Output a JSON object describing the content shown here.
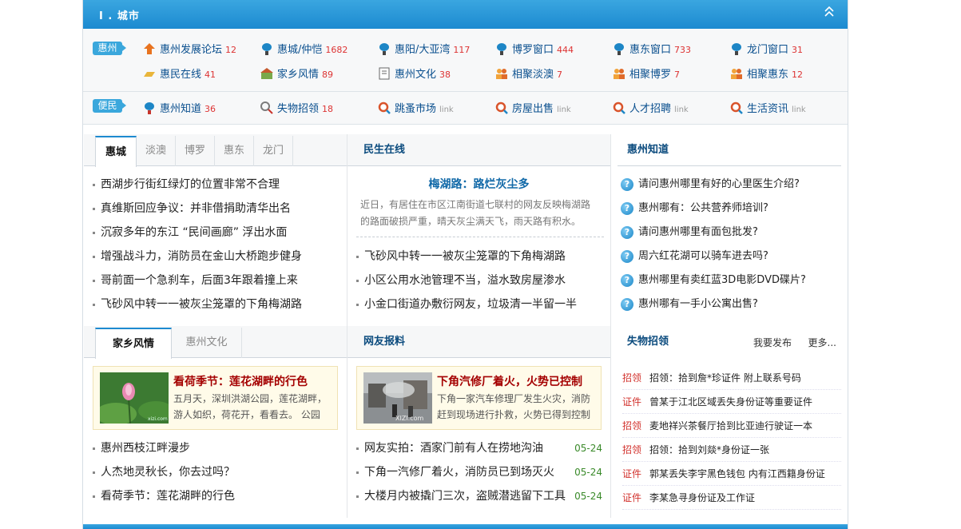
{
  "header": {
    "title": "I . 城市"
  },
  "city": {
    "tag1": "惠州",
    "tag2": "便民",
    "row1": [
      {
        "label": "惠州发展论坛",
        "count": "12",
        "icon": "house-up-icon"
      },
      {
        "label": "惠城/仲恺",
        "count": "1682",
        "icon": "lantern-icon"
      },
      {
        "label": "惠阳/大亚湾",
        "count": "117",
        "icon": "lantern-icon"
      },
      {
        "label": "博罗窗口",
        "count": "444",
        "icon": "lantern-icon"
      },
      {
        "label": "惠东窗口",
        "count": "733",
        "icon": "lantern-icon"
      },
      {
        "label": "龙门窗口",
        "count": "31",
        "icon": "lantern-icon"
      }
    ],
    "row2": [
      {
        "label": "惠民在线",
        "count": "41",
        "icon": "gold-bar-icon"
      },
      {
        "label": "家乡风情",
        "count": "89",
        "icon": "houses-icon"
      },
      {
        "label": "惠州文化",
        "count": "38",
        "icon": "book-icon"
      },
      {
        "label": "相聚淡澳",
        "count": "7",
        "icon": "people-icon"
      },
      {
        "label": "相聚博罗",
        "count": "7",
        "icon": "people-icon"
      },
      {
        "label": "相聚惠东",
        "count": "12",
        "icon": "people-icon"
      }
    ],
    "row3": [
      {
        "label": "惠州知道",
        "count": "36",
        "icon": "question-lantern-icon"
      },
      {
        "label": "失物招领",
        "count": "18",
        "icon": "lost-item-icon"
      },
      {
        "label": "跳蚤市场",
        "link": "link",
        "icon": "magnifier-icon"
      },
      {
        "label": "房屋出售",
        "link": "link",
        "icon": "magnifier-icon"
      },
      {
        "label": "人才招聘",
        "link": "link",
        "icon": "magnifier-icon"
      },
      {
        "label": "生活资讯",
        "link": "link",
        "icon": "magnifier-icon"
      }
    ]
  },
  "col1": {
    "tabs": [
      "惠城",
      "淡澳",
      "博罗",
      "惠东",
      "龙门"
    ],
    "news": [
      "西湖步行街红绿灯的位置非常不合理",
      "真维斯回应争议：并非借捐助清华出名",
      "沉寂多年的东江 “民间画廊” 浮出水面",
      "增强战斗力，消防员在金山大桥跑步健身",
      "哥前面一个急刹车，后面3年跟着撞上来",
      "飞砂风中转一一被灰尘笼罩的下角梅湖路"
    ],
    "tabs2": [
      "家乡风情",
      "惠州文化"
    ],
    "promo": {
      "title": "看荷季节：莲花湖畔的行色",
      "desc": "五月天，深圳洪湖公园，莲花湖畔，游人如织，荷花开，看看去。 公园",
      "img_mark": "xizi.com"
    },
    "news2": [
      "惠州西枝江畔漫步",
      "人杰地灵秋长，你去过吗？",
      "看荷季节：莲花湖畔的行色"
    ]
  },
  "col2": {
    "title": "民生在线",
    "feature_title": "梅湖路：路烂灰尘多",
    "feature_desc": "近日，有居住在市区江南街道七联村的网友反映梅湖路的路面破损严重，晴天灰尘满天飞，雨天路有积水。",
    "news": [
      "飞砂风中转一一被灰尘笼罩的下角梅湖路",
      "小区公用水池管理不当，溢水致房屋渗水",
      "小金口街道办敷衍网友，垃圾清一半留一半"
    ],
    "title2": "网友报料",
    "promo": {
      "title": "下角汽修厂着火，火势已控制",
      "desc": "下角一家汽车修理厂发生火灾，消防赶到现场进行扑救，火势已得到控制",
      "img_mark": "XIZI.com"
    },
    "reports": [
      {
        "text": "网友实拍：酒家门前有人在捞地沟油",
        "date": "05-24"
      },
      {
        "text": "下角一汽修厂着火，消防员已到场灭火",
        "date": "05-24"
      },
      {
        "text": "大楼月内被撬门三次，盗贼潜逃留下工具",
        "date": "05-24"
      }
    ]
  },
  "col3": {
    "title": "惠州知道",
    "questions": [
      "请问惠州哪里有好的心里医生介绍?",
      "惠州哪有：公共营养师培训?",
      "请问惠州哪里有面包批发?",
      "周六红花湖可以骑车进去吗?",
      "惠州哪里有卖红蓝3D电影DVD碟片?",
      "惠州哪有一手小公寓出售?"
    ],
    "title2": "失物招领",
    "publish": "我要发布",
    "more": "更多...",
    "lost": [
      {
        "kind": "招领",
        "text": "招领：拾到詹*珍证件 附上联系号码"
      },
      {
        "kind": "证件",
        "text": "曾某于江北区域丢失身份证等重要证件"
      },
      {
        "kind": "招领",
        "text": "麦地祥兴茶餐厅拾到比亚迪行驶证一本"
      },
      {
        "kind": "招领",
        "text": "招领：拾到刘燚*身份证一张"
      },
      {
        "kind": "证件",
        "text": "郭某丢失李宇黑色钱包 内有江西籍身份证"
      },
      {
        "kind": "证件",
        "text": "李某急寻身份证及工作证"
      }
    ]
  }
}
